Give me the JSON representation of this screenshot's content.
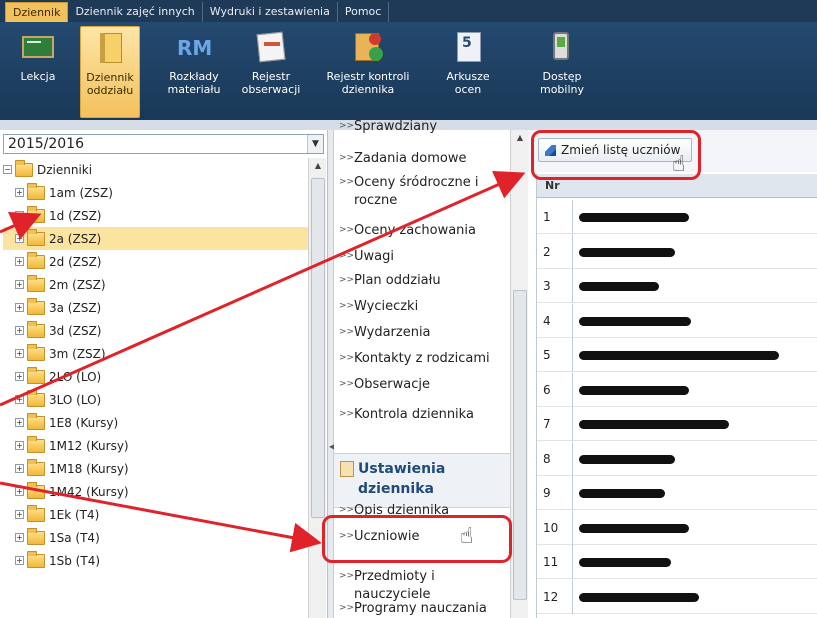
{
  "menu": {
    "tabs": [
      "Dziennik",
      "Dziennik zajęć innych",
      "Wydruki i zestawienia",
      "Pomoc"
    ],
    "active": 0
  },
  "ribbon": {
    "buttons": [
      {
        "label": "Lekcja",
        "icon": "lesson-icon"
      },
      {
        "label": "Dziennik\noddziału",
        "icon": "journal-icon",
        "active": true
      },
      {
        "label": "Rozkłady\nmateriału",
        "icon": "rm-icon"
      },
      {
        "label": "Rejestr\nobserwacji",
        "icon": "observation-register-icon"
      },
      {
        "label": "Rejestr kontroli\ndziennika",
        "icon": "control-register-icon"
      },
      {
        "label": "Arkusze\nocen",
        "icon": "grade-sheet-icon"
      },
      {
        "label": "Dostęp\nmobilny",
        "icon": "mobile-access-icon"
      }
    ],
    "rm_text": "RM",
    "grade_icon_text": "5"
  },
  "left": {
    "year": "2015/2016",
    "root": "Dzienniki",
    "items": [
      "1am (ZSZ)",
      "1d (ZSZ)",
      "2a (ZSZ)",
      "2d (ZSZ)",
      "2m (ZSZ)",
      "3a (ZSZ)",
      "3d (ZSZ)",
      "3m (ZSZ)",
      "2LO (LO)",
      "3LO (LO)",
      "1E8 (Kursy)",
      "1M12 (Kursy)",
      "1M18 (Kursy)",
      "1M42 (Kursy)",
      "1Ek (T4)",
      "1Sa (T4)",
      "1Sb (T4)"
    ],
    "selected": 2
  },
  "middle": {
    "items_top": [
      "Sprawdziany",
      "Zadania domowe",
      "Oceny śródroczne i roczne",
      "Oceny zachowania",
      "Uwagi",
      "Plan oddziału",
      "Wycieczki",
      "Wydarzenia",
      "Kontakty z rodzicami",
      "Obserwacje",
      "Kontrola dziennika"
    ],
    "section": "Ustawienia dziennika",
    "items_bottom": [
      "Opis dziennika",
      "Uczniowie",
      "Przedmioty i nauczyciele",
      "Programy nauczania"
    ]
  },
  "right": {
    "button": "Zmień listę uczniów",
    "column": "Nr",
    "rows": [
      "1",
      "2",
      "3",
      "4",
      "5",
      "6",
      "7",
      "8",
      "9",
      "10",
      "11",
      "12"
    ]
  },
  "colors": {
    "annotation": "#e0232a",
    "menu_bg": "#1f3a57",
    "active_tab": "#f3c15c"
  }
}
